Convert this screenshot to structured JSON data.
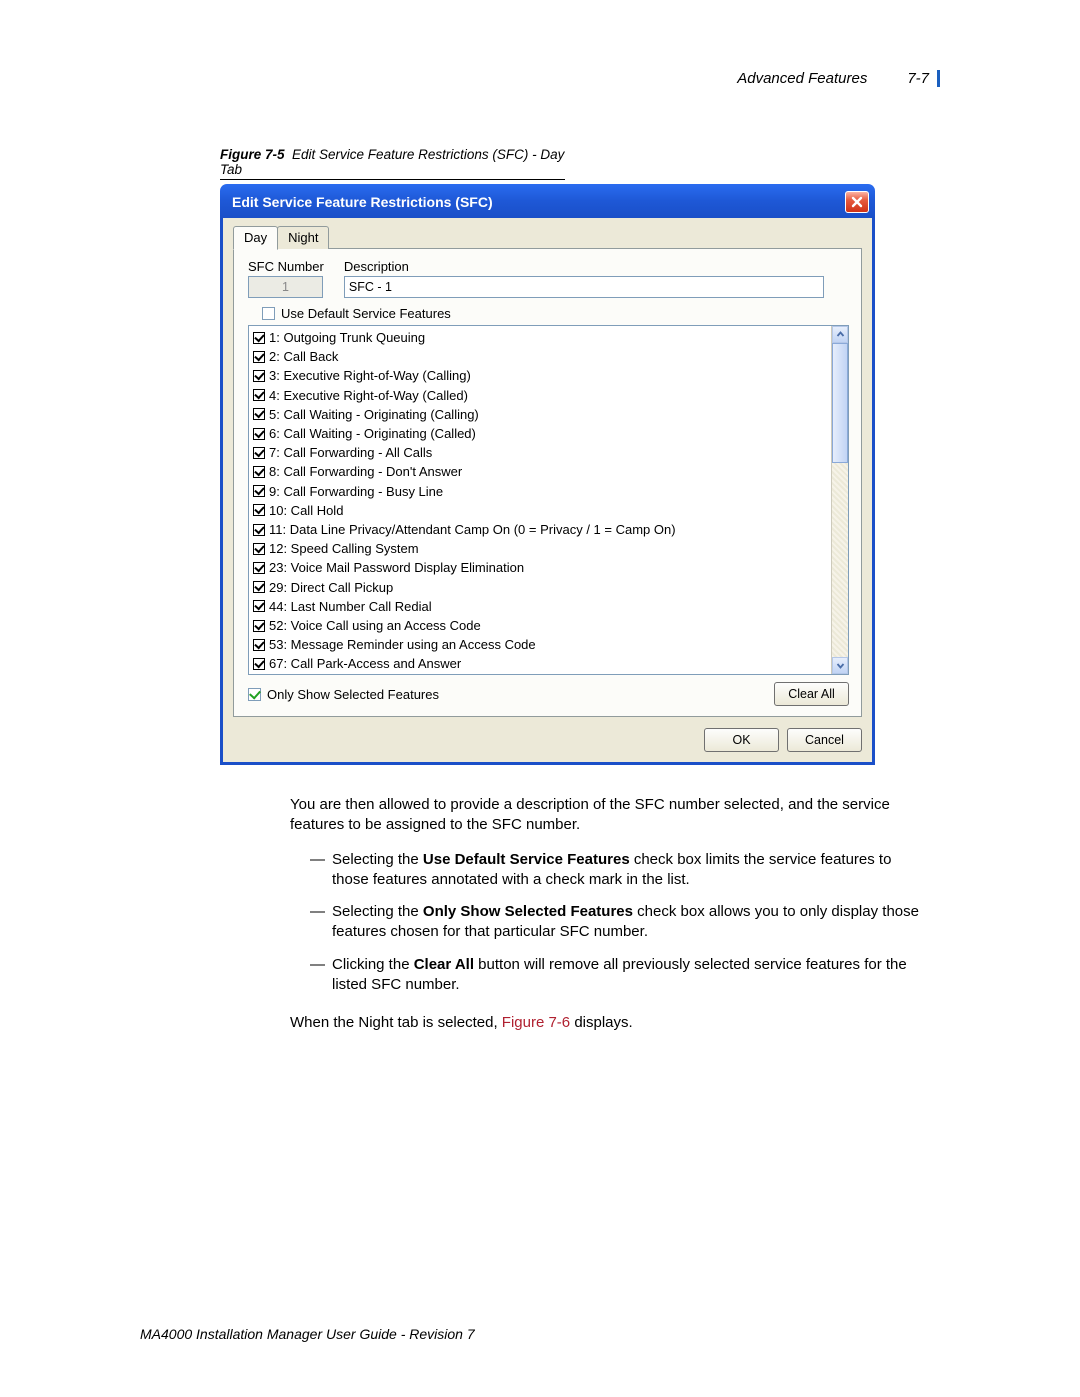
{
  "header": {
    "section": "Advanced Features",
    "page_num": "7-7"
  },
  "figure_caption": {
    "prefix": "Figure 7-5",
    "text": "Edit Service Feature Restrictions (SFC) - Day Tab"
  },
  "dialog": {
    "title": "Edit Service Feature Restrictions (SFC)",
    "tabs": {
      "day": "Day",
      "night": "Night"
    },
    "sfc_number_label": "SFC Number",
    "description_label": "Description",
    "sfc_number_value": "1",
    "description_value": "SFC - 1",
    "use_default_label": "Use Default Service Features",
    "only_show_label": "Only Show Selected Features",
    "clear_all": "Clear All",
    "ok": "OK",
    "cancel": "Cancel",
    "features": [
      "1: Outgoing Trunk Queuing",
      "2: Call Back",
      "3: Executive Right-of-Way (Calling)",
      "4: Executive Right-of-Way (Called)",
      "5: Call Waiting - Originating (Calling)",
      "6: Call Waiting - Originating (Called)",
      "7: Call Forwarding - All Calls",
      "8: Call Forwarding - Don't Answer",
      "9: Call Forwarding - Busy Line",
      "10: Call Hold",
      "11: Data Line Privacy/Attendant Camp On (0 = Privacy / 1 = Camp On)",
      "12: Speed Calling System",
      "23: Voice Mail Password Display Elimination",
      "29: Direct Call Pickup",
      "44: Last Number Call Redial",
      "52: Voice Call using an Access Code",
      "53: Message Reminder using an Access Code",
      "67: Call Park-Access and Answer"
    ]
  },
  "body": {
    "intro": "You are then allowed to provide a description of the SFC number selected, and the service features to be assigned to the SFC number.",
    "b1_pre": "Selecting the ",
    "b1_bold": "Use Default Service Features",
    "b1_post": " check box limits the service features to those features annotated with a check mark in the list.",
    "b2_pre": "Selecting the ",
    "b2_bold": "Only Show Selected Features",
    "b2_post": " check box allows you to only display those features chosen for that particular SFC number.",
    "b3_pre": "Clicking the ",
    "b3_bold": "Clear All",
    "b3_post": " button will remove all previously selected service features for the listed SFC number.",
    "night_pre": "When the Night tab is selected, ",
    "night_ref": "Figure 7-6",
    "night_post": " displays."
  },
  "footer": {
    "text": "MA4000 Installation Manager User Guide - Revision 7"
  }
}
